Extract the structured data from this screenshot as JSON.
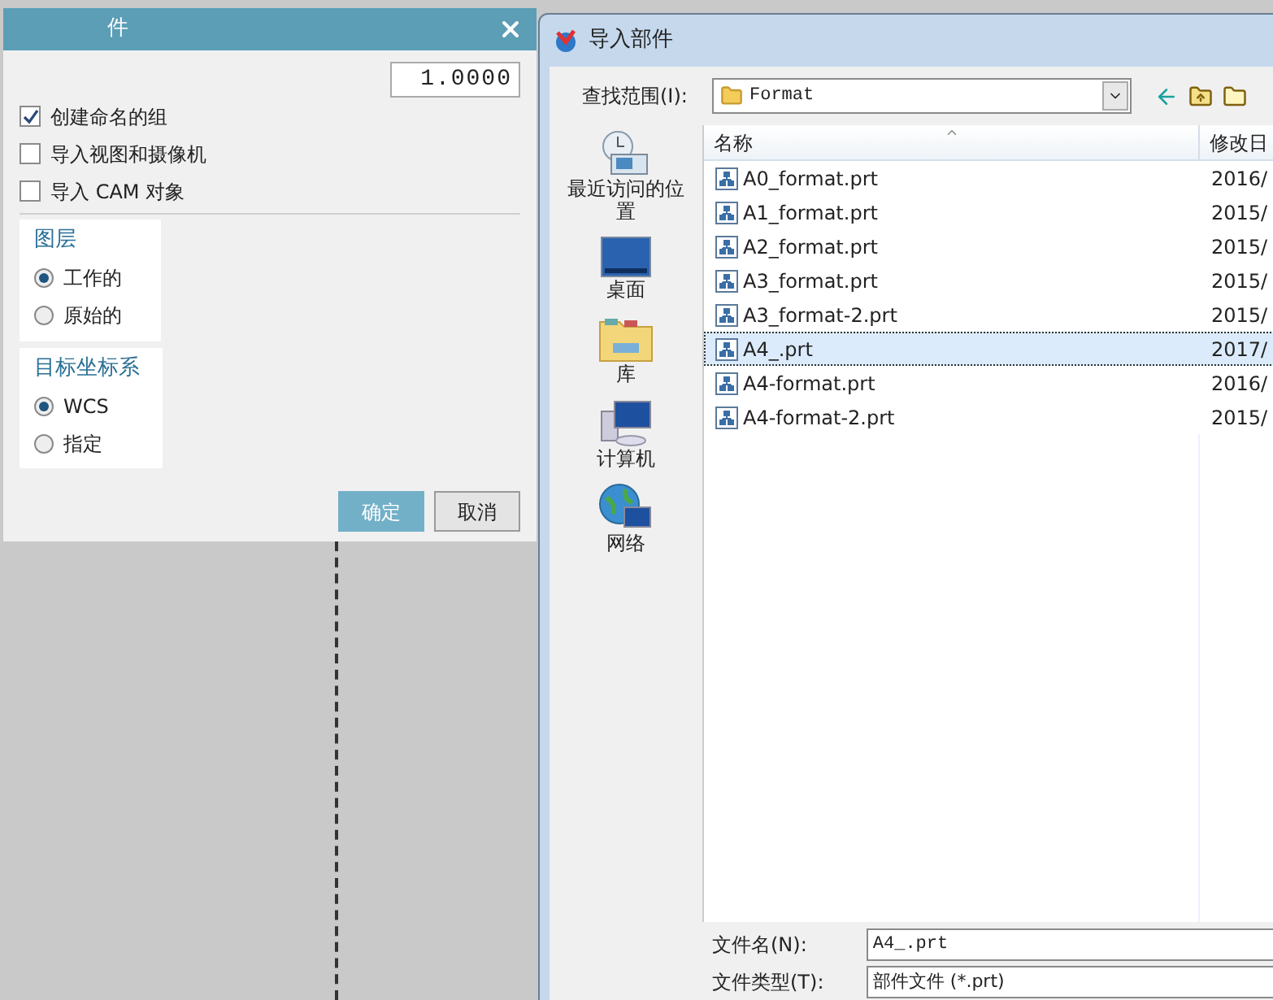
{
  "left_dialog": {
    "title": "件",
    "scale_value": "1.0000",
    "checkboxes": [
      {
        "label": "创建命名的组",
        "checked": true
      },
      {
        "label": "导入视图和摄像机",
        "checked": false
      },
      {
        "label": "导入 CAM 对象",
        "checked": false
      }
    ],
    "groups": [
      {
        "title": "图层",
        "options": [
          {
            "label": "工作的",
            "selected": true
          },
          {
            "label": "原始的",
            "selected": false
          }
        ]
      },
      {
        "title": "目标坐标系",
        "options": [
          {
            "label": "WCS",
            "selected": true
          },
          {
            "label": "指定",
            "selected": false
          }
        ]
      }
    ],
    "buttons": [
      {
        "label": "确定",
        "kind": "primary"
      },
      {
        "label": "取消",
        "kind": "secondary"
      }
    ]
  },
  "right_dialog": {
    "title": "导入部件",
    "look_in_label": "查找范围(I):",
    "look_in_value": "Format",
    "places": [
      {
        "label": "最近访问的位置",
        "kind": "recent"
      },
      {
        "label": "桌面",
        "kind": "desktop"
      },
      {
        "label": "库",
        "kind": "library"
      },
      {
        "label": "计算机",
        "kind": "computer"
      },
      {
        "label": "网络",
        "kind": "network"
      }
    ],
    "columns": [
      "名称",
      "修改日"
    ],
    "rows": [
      {
        "name": "A0_format.prt",
        "date": "2016/",
        "selected": false
      },
      {
        "name": "A1_format.prt",
        "date": "2015/",
        "selected": false
      },
      {
        "name": "A2_format.prt",
        "date": "2015/",
        "selected": false
      },
      {
        "name": "A3_format.prt",
        "date": "2015/",
        "selected": false
      },
      {
        "name": "A3_format-2.prt",
        "date": "2015/",
        "selected": false
      },
      {
        "name": "A4_.prt",
        "date": "2017/",
        "selected": true
      },
      {
        "name": "A4-format.prt",
        "date": "2016/",
        "selected": false
      },
      {
        "name": "A4-format-2.prt",
        "date": "2015/",
        "selected": false
      }
    ],
    "file_name_label": "文件名(N):",
    "file_name_value": "A4_.prt",
    "file_type_label": "文件类型(T):",
    "file_type_value": "部件文件 (*.prt)"
  }
}
